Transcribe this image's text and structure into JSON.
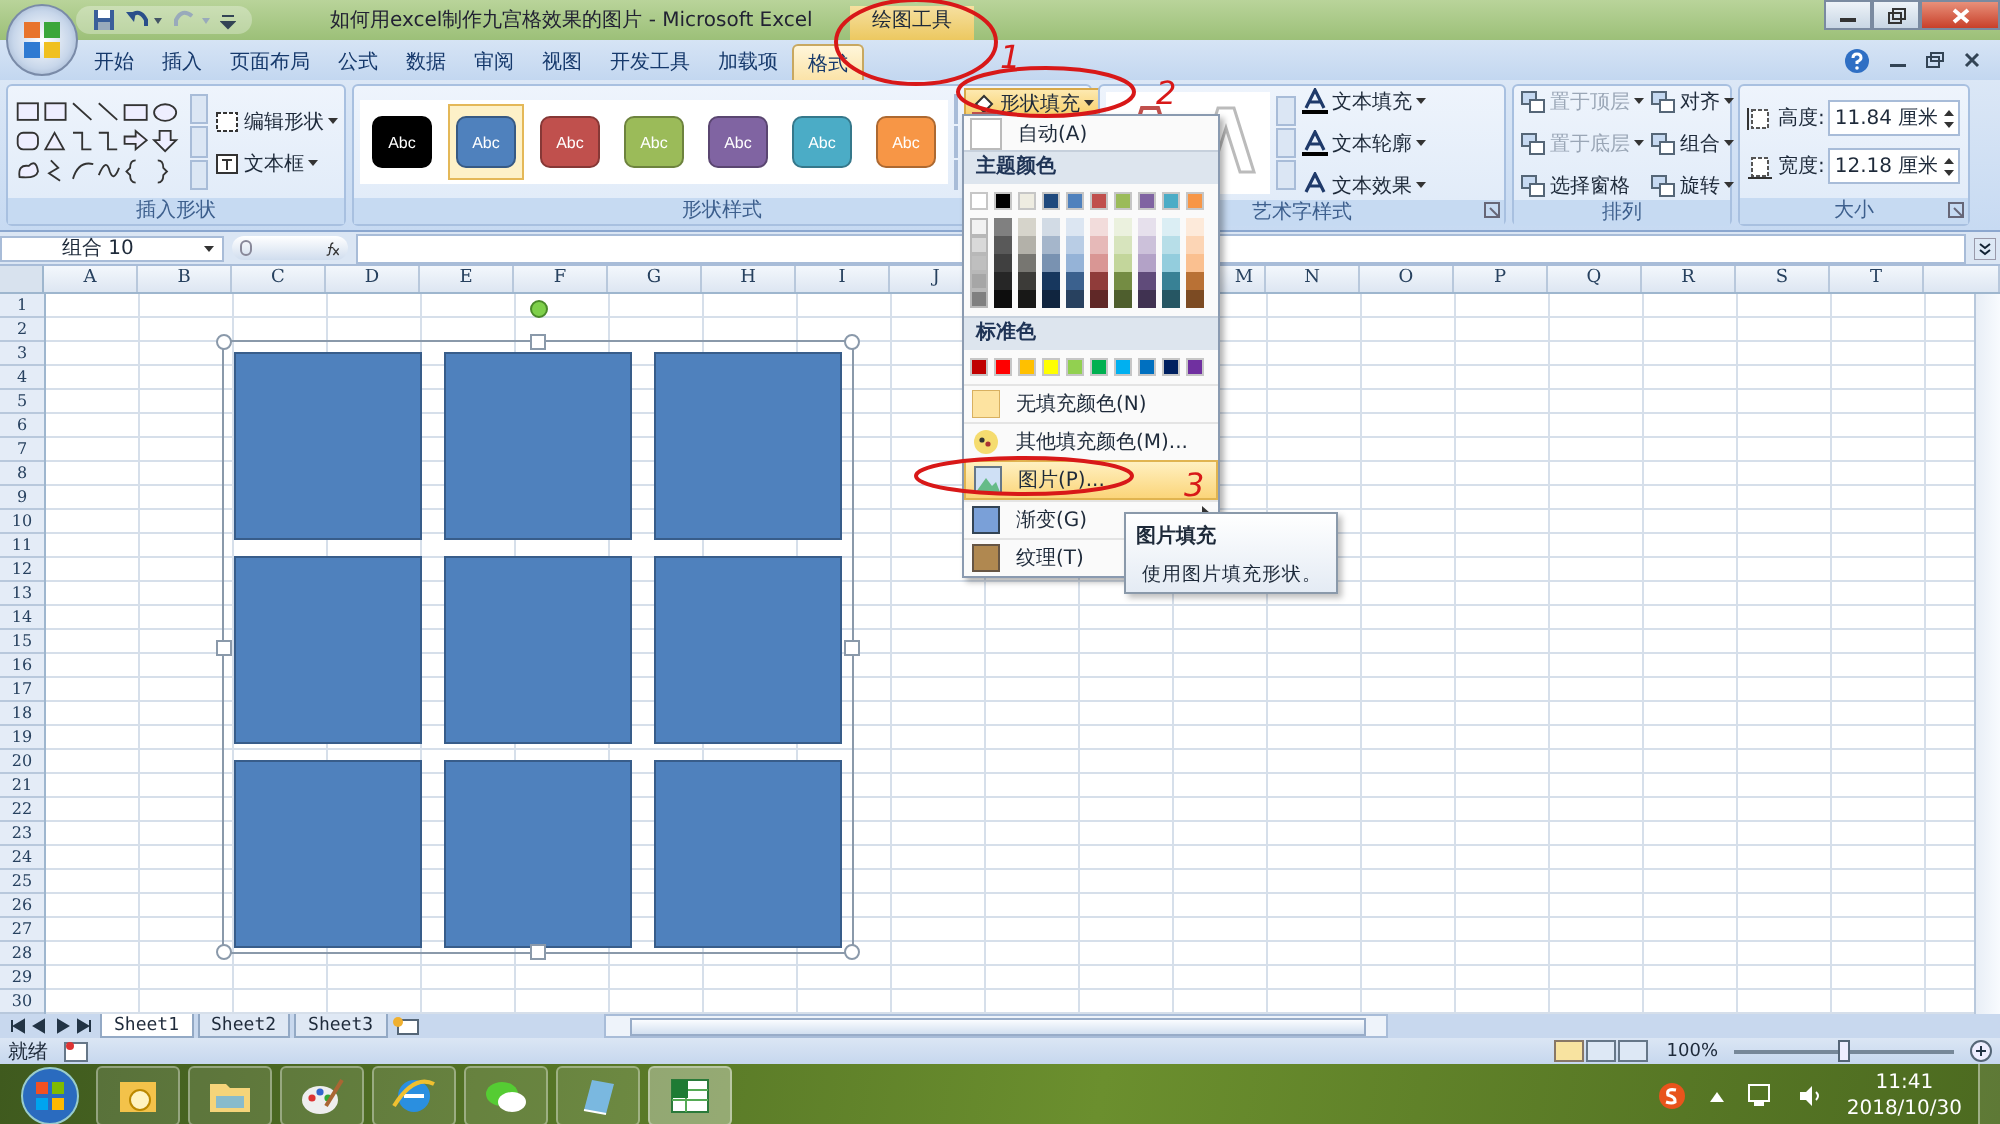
{
  "window": {
    "title": "如何用excel制作九宫格效果的图片 - Microsoft Excel",
    "context_label": "绘图工具"
  },
  "tabs": [
    {
      "label": "开始",
      "selected": false
    },
    {
      "label": "插入",
      "selected": false
    },
    {
      "label": "页面布局",
      "selected": false
    },
    {
      "label": "公式",
      "selected": false
    },
    {
      "label": "数据",
      "selected": false
    },
    {
      "label": "审阅",
      "selected": false
    },
    {
      "label": "视图",
      "selected": false
    },
    {
      "label": "开发工具",
      "selected": false
    },
    {
      "label": "加载项",
      "selected": false
    },
    {
      "label": "格式",
      "selected": true
    }
  ],
  "ribbon": {
    "insert_shapes": {
      "title": "插入形状",
      "buttons": [
        {
          "label": "编辑形状"
        },
        {
          "label": "文本框"
        }
      ]
    },
    "shape_styles": {
      "title": "形状样式",
      "fill_button": "形状填充",
      "swatches": [
        {
          "label": "Abc",
          "color": "#000000",
          "selected": false
        },
        {
          "label": "Abc",
          "color": "#4f81bd",
          "selected": true
        },
        {
          "label": "Abc",
          "color": "#c0504d",
          "selected": false
        },
        {
          "label": "Abc",
          "color": "#9bbb59",
          "selected": false
        },
        {
          "label": "Abc",
          "color": "#8064a2",
          "selected": false
        },
        {
          "label": "Abc",
          "color": "#4bacc6",
          "selected": false
        },
        {
          "label": "Abc",
          "color": "#f79646",
          "selected": false
        }
      ]
    },
    "wordart": {
      "title": "艺术字样式",
      "buttons": [
        {
          "label": "文本填充"
        },
        {
          "label": "文本轮廓"
        },
        {
          "label": "文本效果"
        }
      ]
    },
    "arrange": {
      "title": "排列",
      "buttons": [
        {
          "label": "置于顶层",
          "disabled": true
        },
        {
          "label": "对齐",
          "disabled": false
        },
        {
          "label": "置于底层",
          "disabled": true
        },
        {
          "label": "组合",
          "disabled": false
        },
        {
          "label": "选择窗格",
          "disabled": false
        },
        {
          "label": "旋转",
          "disabled": false
        }
      ]
    },
    "size": {
      "title": "大小",
      "fields": [
        {
          "label": "高度:",
          "value": "11.84 厘米"
        },
        {
          "label": "宽度:",
          "value": "12.18 厘米"
        }
      ]
    }
  },
  "formula_bar": {
    "name_box": "组合 10"
  },
  "sheet": {
    "columns": [
      "A",
      "B",
      "C",
      "D",
      "E",
      "F",
      "G",
      "H",
      "I",
      "J"
    ],
    "columns_after_menu": [
      "M",
      "N",
      "O",
      "P",
      "Q",
      "R",
      "S",
      "T"
    ],
    "rows": [
      "1",
      "2",
      "3",
      "4",
      "5",
      "6",
      "7",
      "8",
      "9",
      "10",
      "11",
      "12",
      "13",
      "14",
      "15",
      "16",
      "17",
      "18",
      "19",
      "20",
      "21",
      "22",
      "23",
      "24",
      "25",
      "26",
      "27",
      "28",
      "29",
      "30"
    ]
  },
  "fill_menu": {
    "auto": "自动(A)",
    "theme_title": "主题颜色",
    "theme_colors": [
      {
        "color": "#ffffff"
      },
      {
        "color": "#000000"
      },
      {
        "color": "#eeece1"
      },
      {
        "color": "#1f497d"
      },
      {
        "color": "#4f81bd"
      },
      {
        "color": "#c0504d"
      },
      {
        "color": "#9bbb59"
      },
      {
        "color": "#8064a2"
      },
      {
        "color": "#4bacc6"
      },
      {
        "color": "#f79646"
      }
    ],
    "standard_title": "标准色",
    "standard_colors": [
      {
        "color": "#c00000"
      },
      {
        "color": "#ff0000"
      },
      {
        "color": "#ffc000"
      },
      {
        "color": "#ffff00"
      },
      {
        "color": "#92d050"
      },
      {
        "color": "#00b050"
      },
      {
        "color": "#00b0f0"
      },
      {
        "color": "#0070c0"
      },
      {
        "color": "#002060"
      },
      {
        "color": "#7030a0"
      }
    ],
    "items": [
      {
        "label": "无填充颜色(N)",
        "selected": false,
        "submenu": false
      },
      {
        "label": "其他填充颜色(M)...",
        "selected": false,
        "submenu": false
      },
      {
        "label": "图片(P)...",
        "selected": true,
        "submenu": false
      },
      {
        "label": "渐变(G)",
        "selected": false,
        "submenu": true
      },
      {
        "label": "纹理(T)",
        "selected": false
      }
    ]
  },
  "tooltip": {
    "title": "图片填充",
    "text": "使用图片填充形状。"
  },
  "sheet_tabs": [
    {
      "label": "Sheet1",
      "selected": true
    },
    {
      "label": "Sheet2",
      "selected": false
    },
    {
      "label": "Sheet3",
      "selected": false
    }
  ],
  "status_bar": {
    "text": "就绪",
    "zoom": "100%",
    "zoom_slider": {
      "level": 0.5
    }
  },
  "taskbar": {
    "time": "11:41",
    "date": "2018/10/30"
  },
  "annotations": [
    {
      "mark": "1"
    },
    {
      "mark": "2"
    },
    {
      "mark": "3"
    }
  ]
}
